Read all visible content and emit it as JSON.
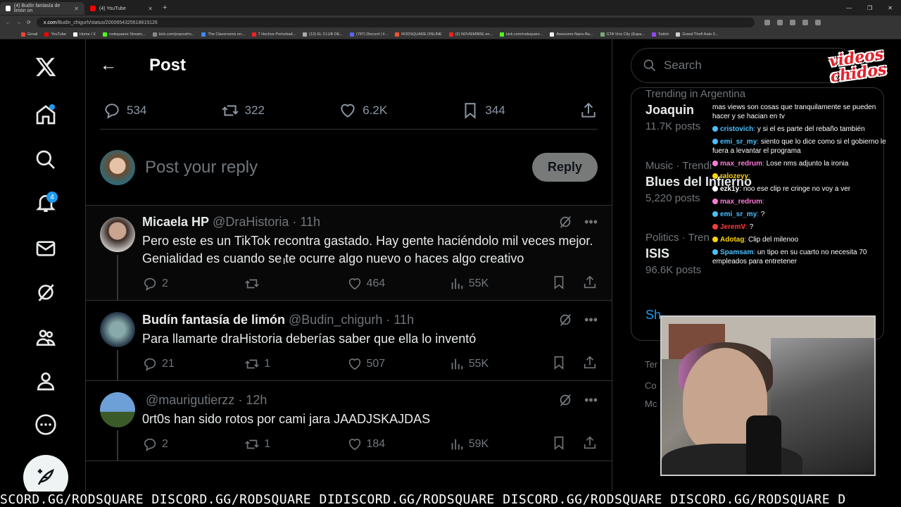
{
  "browser": {
    "tabs": [
      {
        "label": "(4) Budín fantasía de limón on",
        "active": true
      },
      {
        "label": "(4) YouTube",
        "active": false
      }
    ],
    "new_tab": "+",
    "url_domain": "x.com",
    "url_path": "/Budin_chigurh/status/2000654325618819126",
    "bookmarks": [
      "Gmail",
      "YouTube",
      "Home / X",
      "rodsquaree Stream...",
      "kick.com/popout/ro...",
      "The Classrooms en...",
      "7 Hechos Perturbad...",
      "(13) EL CLUB DE...",
      "(787) Discord | #...",
      "RODSQUARE.ONLINE",
      "(2) NOVIEMBRE en...",
      "kick.com/rodsquare...",
      "Awesome-Nano-Ba...",
      "GTA Vice City (Espa...",
      "Twitch",
      "Grand Theft Auto 3..."
    ]
  },
  "nav": {
    "notifications_count": "4"
  },
  "header": {
    "back": "←",
    "title": "Post"
  },
  "post_stats": {
    "replies": "534",
    "reposts": "322",
    "likes": "6.2K",
    "bookmarks": "344"
  },
  "reply_box": {
    "placeholder": "Post your reply",
    "button": "Reply"
  },
  "replies": [
    {
      "name": "Micaela HP",
      "handle": "@DraHistoria",
      "time": "· 11h",
      "text": "Pero este es un TikTok recontra gastado. Hay gente haciéndolo mil veces mejor. Genialidad es cuando se te ocurre algo nuevo o haces algo creativo",
      "replies": "2",
      "reposts": "",
      "likes": "464",
      "views": "55K"
    },
    {
      "name": "Budín fantasía de limón",
      "handle": "@Budin_chigurh",
      "time": "· 11h",
      "text": "Para llamarte draHistoria deberías saber que ella lo inventó",
      "replies": "21",
      "reposts": "1",
      "likes": "507",
      "views": "55K"
    },
    {
      "name": "",
      "handle": "@maurigutierzz",
      "time": "· 12h",
      "text": "0rt0s han sido rotos por cami jara JAADJSKAJDAS",
      "replies": "2",
      "reposts": "1",
      "likes": "184",
      "views": "59K"
    }
  ],
  "sidebar": {
    "search_placeholder": "Search",
    "trends": [
      {
        "context": "Trending in Argentina",
        "name": "Joaquin",
        "posts": "11.7K posts"
      },
      {
        "context": "Music · Trendi",
        "name": "Blues del Infierno",
        "posts": "5,220 posts"
      },
      {
        "context": "Politics · Tren",
        "name": "ISIS",
        "posts": "96.6K posts"
      }
    ],
    "show_more": "Sh",
    "footer": [
      "Ter",
      "Co",
      "Mc"
    ]
  },
  "stream_chat": [
    {
      "user": "",
      "text": "mas views son cosas que tranquilamente se pueden hacer y se hacian en tv",
      "color": "#ffffff"
    },
    {
      "user": "cristovich",
      "text": "y si el es parte del rebaño también",
      "color": "#49c1ff"
    },
    {
      "user": "emi_sr_my",
      "text": "siento que lo dice como si el gobierno le fuera a levantar el programa",
      "color": "#49c1ff"
    },
    {
      "user": "max_redrum",
      "text": "Lose nms adjunto la ironia",
      "color": "#ff7ad9"
    },
    {
      "user": "ralozeyy",
      "text": "",
      "color": "#ffd400"
    },
    {
      "user": "ezk1y",
      "text": "noo ese clip re cringe no voy a ver",
      "color": "#ffffff"
    },
    {
      "user": "max_redrum",
      "text": "",
      "color": "#ff7ad9"
    },
    {
      "user": "emi_sr_my",
      "text": "?",
      "color": "#49c1ff"
    },
    {
      "user": "JeremV",
      "text": "?",
      "color": "#ff3b3b"
    },
    {
      "user": "Adotag",
      "text": "Clip del milenoo",
      "color": "#ffd400"
    },
    {
      "user": "Spamsam",
      "text": "un tipo en su cuarto no necesita 70 empleados para entretener",
      "color": "#49c1ff"
    }
  ],
  "overlay_logo": [
    "videos",
    "chidos"
  ],
  "ticker_text": "SCORD.GG/RODSQUARE DISCORD.GG/RODSQUARE DIDISCORD.GG/RODSQUARE DISCORD.GG/RODSQUARE DISCORD.GG/RODSQUARE D"
}
